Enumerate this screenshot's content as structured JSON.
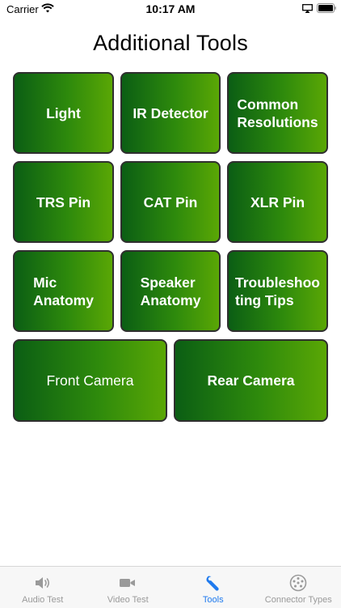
{
  "status_bar": {
    "carrier": "Carrier",
    "time": "10:17 AM"
  },
  "page": {
    "title": "Additional Tools"
  },
  "tools": {
    "light": "Light",
    "ir_detector": "IR Detector",
    "common_resolutions": "Common\nResolutions",
    "trs_pin": "TRS Pin",
    "cat_pin": "CAT Pin",
    "xlr_pin": "XLR Pin",
    "mic_anatomy": "Mic\nAnatomy",
    "speaker_anatomy": "Speaker\nAnatomy",
    "troubleshooting_tips": "Troubleshoo\nting Tips",
    "front_camera": "Front Camera",
    "rear_camera": "Rear Camera"
  },
  "tab_bar": {
    "audio_test": "Audio Test",
    "video_test": "Video Test",
    "tools": "Tools",
    "connector_types": "Connector Types",
    "active_tab": "Tools"
  },
  "colors": {
    "tile_dark": "#0b5e14",
    "tile_light": "#5aa705",
    "tab_active": "#1f7aee",
    "tab_inactive": "#9a9a9a"
  },
  "icons": {
    "audio_test": "speaker-icon",
    "video_test": "video-camera-icon",
    "tools": "wrench-icon",
    "connector_types": "connector-plug-icon"
  }
}
